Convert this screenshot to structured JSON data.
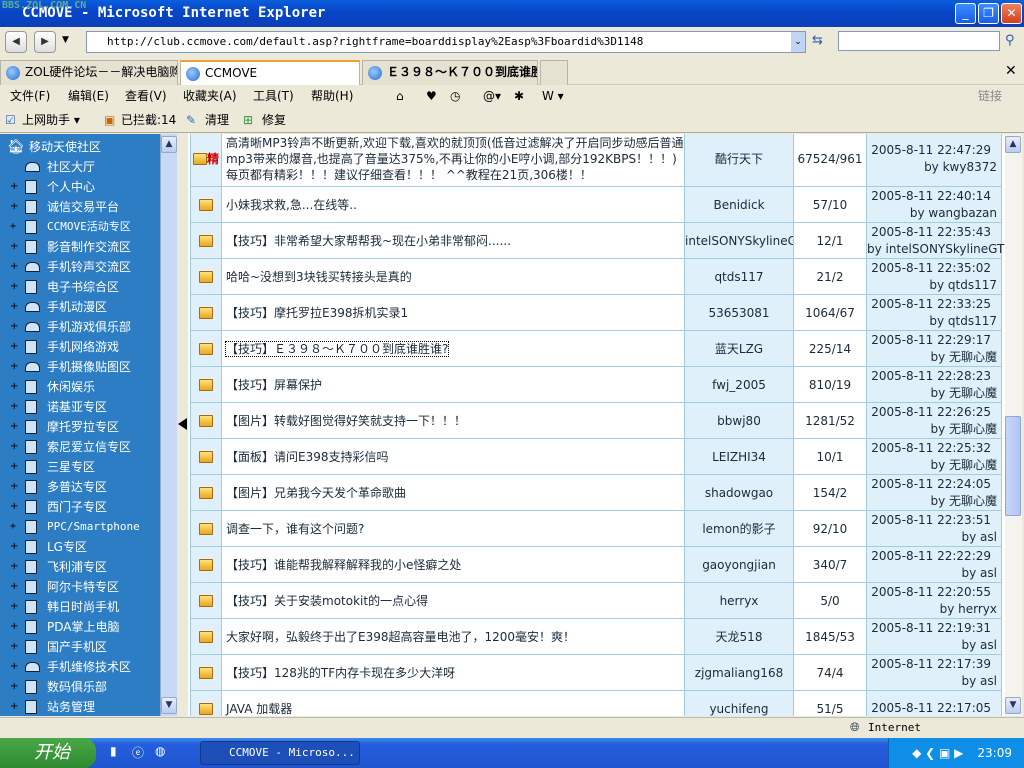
{
  "window": {
    "title": "CCMOVE - Microsoft Internet Explorer",
    "watermark": "BBS.ZOL.COM.CN"
  },
  "address": {
    "url": "http://club.ccmove.com/default.asp?rightframe=boarddisplay%2Easp%3Fboardid%3D1148",
    "search_value": ""
  },
  "tabs": [
    {
      "label": "ZOL硬件论坛－－解决电脑购"
    },
    {
      "label": "CCMOVE"
    },
    {
      "label": "Ｅ３９８～Ｋ７００到底谁胜"
    }
  ],
  "menu": [
    "文件(F)",
    "编辑(E)",
    "查看(V)",
    "收藏夹(A)",
    "工具(T)",
    "帮助(H)"
  ],
  "links_label": "链接",
  "toolbar2": {
    "assistant": "上网助手",
    "blocked": "已拦截:14",
    "clean": "清理",
    "repair": "修复"
  },
  "sidebar": {
    "root": "移动天使社区",
    "items": [
      {
        "label": "社区大厅",
        "icon": "hat"
      },
      {
        "label": "个人中心",
        "icon": "book"
      },
      {
        "label": "诚信交易平台",
        "icon": "book"
      },
      {
        "label": "CCMOVE活动专区",
        "icon": "book"
      },
      {
        "label": "影音制作交流区",
        "icon": "book"
      },
      {
        "label": "手机铃声交流区",
        "icon": "hat"
      },
      {
        "label": "电子书综合区",
        "icon": "book"
      },
      {
        "label": "手机动漫区",
        "icon": "hat"
      },
      {
        "label": "手机游戏俱乐部",
        "icon": "hat"
      },
      {
        "label": "手机网络游戏",
        "icon": "book"
      },
      {
        "label": "手机摄像贴图区",
        "icon": "hat"
      },
      {
        "label": "休闲娱乐",
        "icon": "book"
      },
      {
        "label": "诺基亚专区",
        "icon": "book"
      },
      {
        "label": "摩托罗拉专区",
        "icon": "book"
      },
      {
        "label": "索尼爱立信专区",
        "icon": "book"
      },
      {
        "label": "三星专区",
        "icon": "book"
      },
      {
        "label": "多普达专区",
        "icon": "book"
      },
      {
        "label": "西门子专区",
        "icon": "book"
      },
      {
        "label": "PPC/Smartphone",
        "icon": "book"
      },
      {
        "label": "LG专区",
        "icon": "book"
      },
      {
        "label": "飞利浦专区",
        "icon": "book"
      },
      {
        "label": "阿尔卡特专区",
        "icon": "book"
      },
      {
        "label": "韩日时尚手机",
        "icon": "book"
      },
      {
        "label": "PDA掌上电脑",
        "icon": "book"
      },
      {
        "label": "国产手机区",
        "icon": "book"
      },
      {
        "label": "手机维修技术区",
        "icon": "hat"
      },
      {
        "label": "数码俱乐部",
        "icon": "book"
      },
      {
        "label": "站务管理",
        "icon": "book"
      }
    ]
  },
  "topics": [
    {
      "badge": "精",
      "title": "高清晰MP3铃声不断更新,欢迎下载,喜欢的就顶顶(低音过滤解决了开启同步动感后普通mp3带来的爆音,也提高了音量达375%,不再让你的小E哼小调,部分192KBPS！！！)每页都有精彩！！！建议仔细查看！！！ ^^教程在21页,306楼！！",
      "author": "酷行天下",
      "count": "67524/961",
      "date": "2005-8-11 22:47:29",
      "by": "by kwy8372"
    },
    {
      "title": "小妹我求救,急...在线等..",
      "author": "Benidick",
      "count": "57/10",
      "date": "2005-8-11 22:40:14",
      "by": "by wangbazan"
    },
    {
      "title": "【技巧】非常希望大家帮帮我~现在小弟非常郁闷......",
      "author": "intelSONYSkylineGT",
      "count": "12/1",
      "date": "2005-8-11 22:35:43",
      "by": "by intelSONYSkylineGT"
    },
    {
      "title": "哈哈~没想到3块钱买转接头是真的",
      "author": "qtds117",
      "count": "21/2",
      "date": "2005-8-11 22:35:02",
      "by": "by qtds117"
    },
    {
      "title": "【技巧】摩托罗拉E398拆机实录1",
      "author": "53653081",
      "count": "1064/67",
      "date": "2005-8-11 22:33:25",
      "by": "by qtds117"
    },
    {
      "title": "【技巧】Ｅ３９８～Ｋ７００到底谁胜谁?",
      "author": "蓝天LZG",
      "count": "225/14",
      "date": "2005-8-11 22:29:17",
      "by": "by 无聊心魔",
      "selected": true
    },
    {
      "title": "【技巧】屏幕保护",
      "author": "fwj_2005",
      "count": "810/19",
      "date": "2005-8-11 22:28:23",
      "by": "by 无聊心魔"
    },
    {
      "title": "【图片】转载好图觉得好笑就支持一下！！！",
      "author": "bbwj80",
      "count": "1281/52",
      "date": "2005-8-11 22:26:25",
      "by": "by 无聊心魔"
    },
    {
      "title": "【面板】请问E398支持彩信吗",
      "author": "LEIZHI34",
      "count": "10/1",
      "date": "2005-8-11 22:25:32",
      "by": "by 无聊心魔"
    },
    {
      "title": "【图片】兄弟我今天发个革命歌曲",
      "author": "shadowgao",
      "count": "154/2",
      "date": "2005-8-11 22:24:05",
      "by": "by 无聊心魔"
    },
    {
      "title": "调查一下，谁有这个问题?",
      "author": "lemon的影子",
      "count": "92/10",
      "date": "2005-8-11 22:23:51",
      "by": "by asl"
    },
    {
      "title": "【技巧】谁能帮我解释解释我的小e怪癖之处",
      "author": "gaoyongjian",
      "count": "340/7",
      "date": "2005-8-11 22:22:29",
      "by": "by asl"
    },
    {
      "title": "【技巧】关于安装motokit的一点心得",
      "author": "herryx",
      "count": "5/0",
      "date": "2005-8-11 22:20:55",
      "by": "by herryx"
    },
    {
      "title": "大家好啊，弘毅终于出了E398超高容量电池了，1200毫安！爽！",
      "author": "天龙518",
      "count": "1845/53",
      "date": "2005-8-11 22:19:31",
      "by": "by asl"
    },
    {
      "title": "【技巧】128兆的TF内存卡现在多少大洋呀",
      "author": "zjgmaliang168",
      "count": "74/4",
      "date": "2005-8-11 22:17:39",
      "by": "by asl"
    },
    {
      "title": "JAVA 加载器",
      "author": "yuchifeng",
      "count": "51/5",
      "date": "2005-8-11 22:17:05",
      "by": ""
    }
  ],
  "status": {
    "zone": "Internet"
  },
  "taskbar": {
    "start": "开始",
    "task": "CCMOVE - Microso...",
    "clock": "23:09"
  }
}
